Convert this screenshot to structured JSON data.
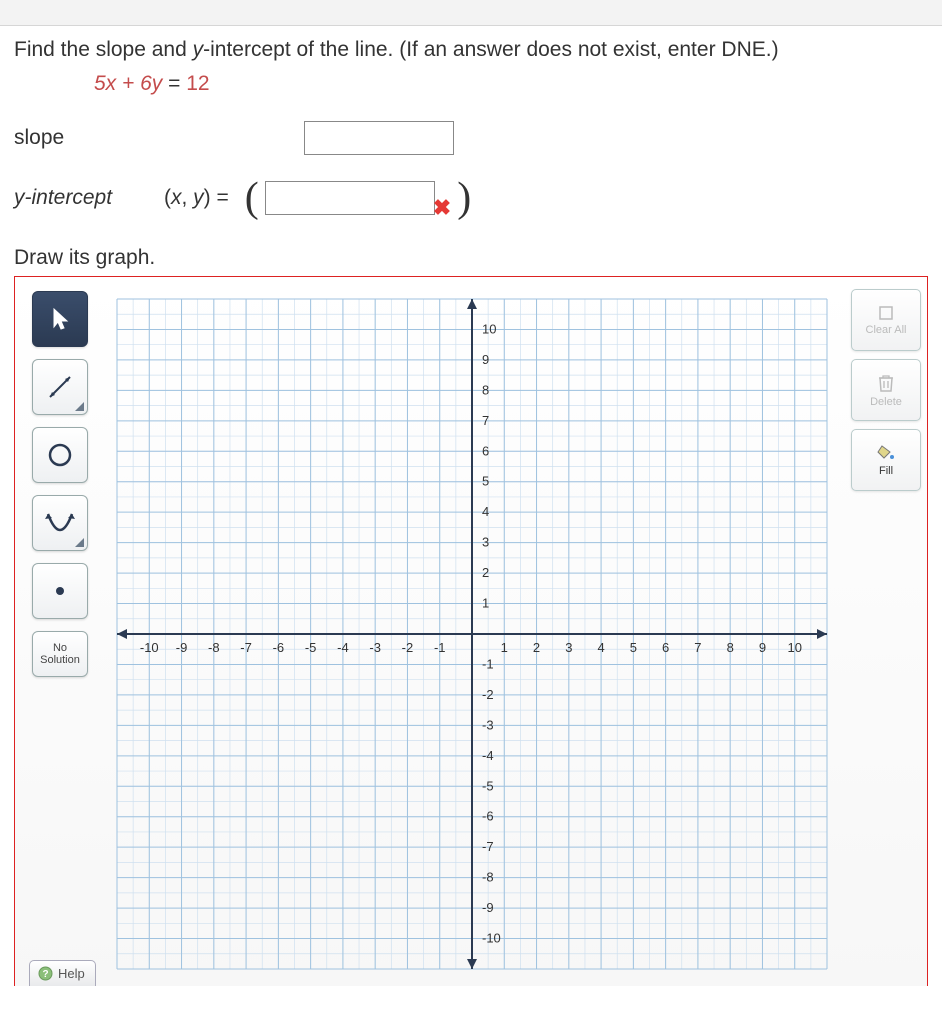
{
  "question": {
    "prompt_pre": "Find the slope and ",
    "y_intercept_word": "y",
    "prompt_mid": "-intercept of the line. (If an answer does not exist, enter DNE.)",
    "equation_lhs": "5x + 6y",
    "equation_eq": " = ",
    "equation_rhs": "12"
  },
  "labels": {
    "slope": "slope",
    "y_intercept": "y-intercept",
    "xy_prefix": "(x, y) = ",
    "draw": "Draw its graph."
  },
  "inputs": {
    "slope_value": "",
    "yint_value": ""
  },
  "feedback": {
    "yint_wrong_glyph": "✖"
  },
  "tools": {
    "no_solution_line1": "No",
    "no_solution_line2": "Solution",
    "help": "Help"
  },
  "right_buttons": {
    "clear_all": "Clear All",
    "delete": "Delete",
    "fill": "Fill"
  },
  "chart_data": {
    "type": "scatter",
    "title": "",
    "xlabel": "",
    "ylabel": "",
    "xlim": [
      -11,
      11
    ],
    "ylim": [
      -11,
      11
    ],
    "x_ticks": [
      -10,
      -9,
      -8,
      -7,
      -6,
      -5,
      -4,
      -3,
      -2,
      -1,
      1,
      2,
      3,
      4,
      5,
      6,
      7,
      8,
      9,
      10
    ],
    "y_ticks": [
      -10,
      -9,
      -8,
      -7,
      -6,
      -5,
      -4,
      -3,
      -2,
      -1,
      1,
      2,
      3,
      4,
      5,
      6,
      7,
      8,
      9,
      10
    ],
    "grid": true,
    "series": []
  }
}
